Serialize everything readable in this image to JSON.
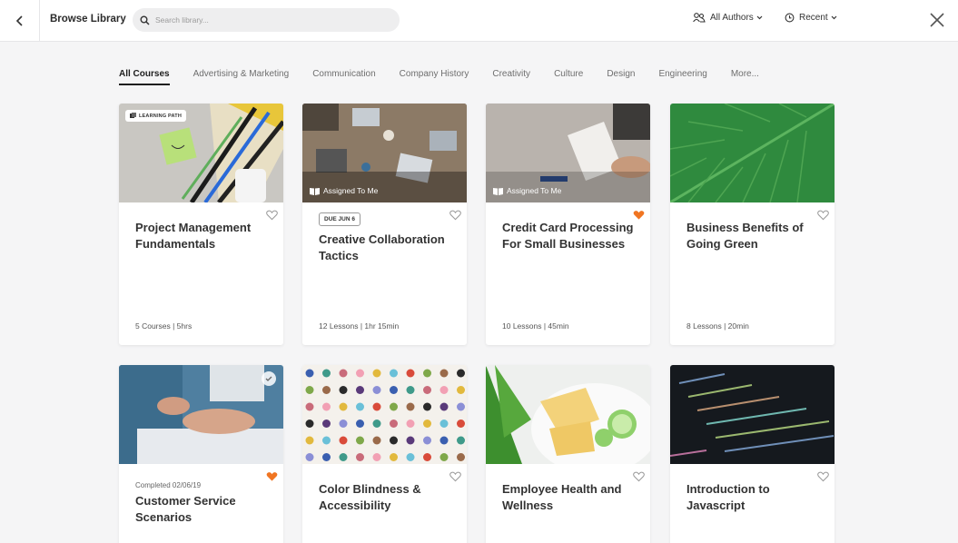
{
  "header": {
    "title": "Browse Library",
    "search_placeholder": "Search library...",
    "authors_filter": "All Authors",
    "recent_filter": "Recent"
  },
  "tabs": [
    {
      "label": "All Courses",
      "active": true
    },
    {
      "label": "Advertising & Marketing"
    },
    {
      "label": "Communication"
    },
    {
      "label": "Company History"
    },
    {
      "label": "Creativity"
    },
    {
      "label": "Culture"
    },
    {
      "label": "Design"
    },
    {
      "label": "Engineering"
    },
    {
      "label": "More..."
    }
  ],
  "cards": [
    {
      "title": "Project Management Fundamentals",
      "meta": "5 Courses | 5hrs",
      "badge": "LEARNING PATH",
      "favorited": false
    },
    {
      "title": "Creative Collaboration Tactics",
      "meta": "12 Lessons  |  1hr 15min",
      "overlay": "Assigned To Me",
      "due": "DUE JUN 6",
      "favorited": false
    },
    {
      "title": "Credit Card Processing For Small Businesses",
      "meta": "10 Lessons  |  45min",
      "overlay": "Assigned To Me",
      "favorited": true
    },
    {
      "title": "Business Benefits of Going Green",
      "meta": "8 Lessons  |  20min",
      "favorited": false
    },
    {
      "title": "Customer Service Scenarios",
      "completed": "Completed 02/06/19",
      "favorited": true,
      "done": true
    },
    {
      "title": "Color Blindness & Accessibility",
      "favorited": false
    },
    {
      "title": "Employee Health and Wellness",
      "favorited": false
    },
    {
      "title": "Introduction to Javascript",
      "favorited": false
    }
  ],
  "colors": {
    "heart_active": "#f07522",
    "heart_inactive": "#9a9a9a",
    "accent": "#1e1e1e"
  }
}
